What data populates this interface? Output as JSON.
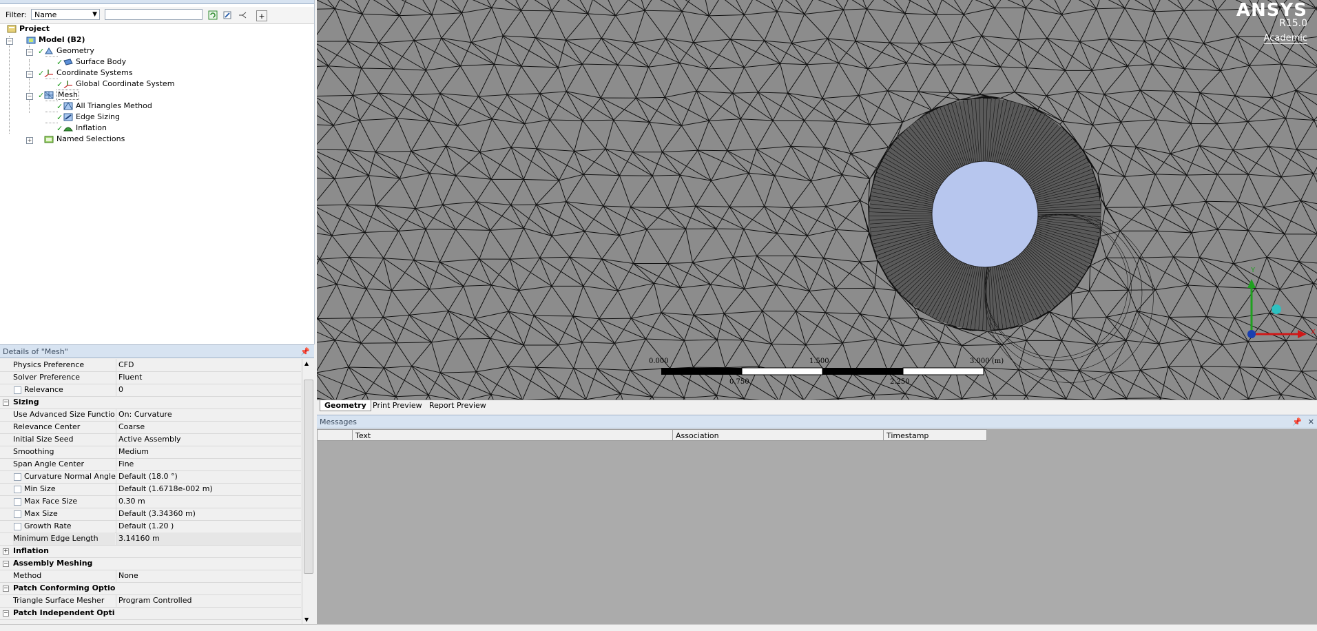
{
  "outline": {
    "filter_label": "Filter:",
    "filter_value": "Name",
    "tree": [
      {
        "label": "Project"
      },
      {
        "label": "Model (B2)"
      },
      {
        "label": "Geometry"
      },
      {
        "label": "Surface Body"
      },
      {
        "label": "Coordinate Systems"
      },
      {
        "label": "Global Coordinate System"
      },
      {
        "label": "Mesh"
      },
      {
        "label": "All Triangles Method"
      },
      {
        "label": "Edge Sizing"
      },
      {
        "label": "Inflation"
      },
      {
        "label": "Named Selections"
      }
    ]
  },
  "details": {
    "title": "Details of \"Mesh\"",
    "rows": [
      {
        "label": "Physics Preference",
        "value": "CFD"
      },
      {
        "label": "Solver Preference",
        "value": "Fluent"
      },
      {
        "label": "Relevance",
        "value": "0"
      },
      {
        "label": "Sizing",
        "value": ""
      },
      {
        "label": "Use Advanced Size Function",
        "value": "On: Curvature"
      },
      {
        "label": "Relevance Center",
        "value": "Coarse"
      },
      {
        "label": "Initial Size Seed",
        "value": "Active Assembly"
      },
      {
        "label": "Smoothing",
        "value": "Medium"
      },
      {
        "label": "Span Angle Center",
        "value": "Fine"
      },
      {
        "label": "Curvature Normal Angle",
        "value": "Default (18.0 °)"
      },
      {
        "label": "Min Size",
        "value": "Default (1.6718e-002 m)"
      },
      {
        "label": "Max Face Size",
        "value": "0.30 m"
      },
      {
        "label": "Max Size",
        "value": "Default (3.34360 m)"
      },
      {
        "label": "Growth Rate",
        "value": "Default (1.20 )"
      },
      {
        "label": "Minimum Edge Length",
        "value": "3.14160 m"
      },
      {
        "label": "Inflation",
        "value": ""
      },
      {
        "label": "Assembly Meshing",
        "value": ""
      },
      {
        "label": "Method",
        "value": "None"
      },
      {
        "label": "Patch Conforming Options",
        "value": ""
      },
      {
        "label": "Triangle Surface Mesher",
        "value": "Program Controlled"
      },
      {
        "label": "Patch Independent Options",
        "value": ""
      }
    ]
  },
  "viewport": {
    "brand": "ANSYS",
    "version": "R15.0",
    "edition": "Academic",
    "scale_labels": [
      "0.000",
      "1.500",
      "3.000 (m)",
      "0.750",
      "2.250"
    ],
    "axis_label_y": "Y",
    "axis_label_x": "X"
  },
  "tabs": [
    "Geometry",
    "Print Preview",
    "Report Preview"
  ],
  "messages": {
    "title": "Messages",
    "columns": [
      "Text",
      "Association",
      "Timestamp"
    ]
  },
  "colors": {
    "viewport_bg": "#8c8c8c",
    "circle_fill": "#b7c6ee",
    "panel_header": "#d7e3f1",
    "check_green": "#1b9b1b"
  }
}
